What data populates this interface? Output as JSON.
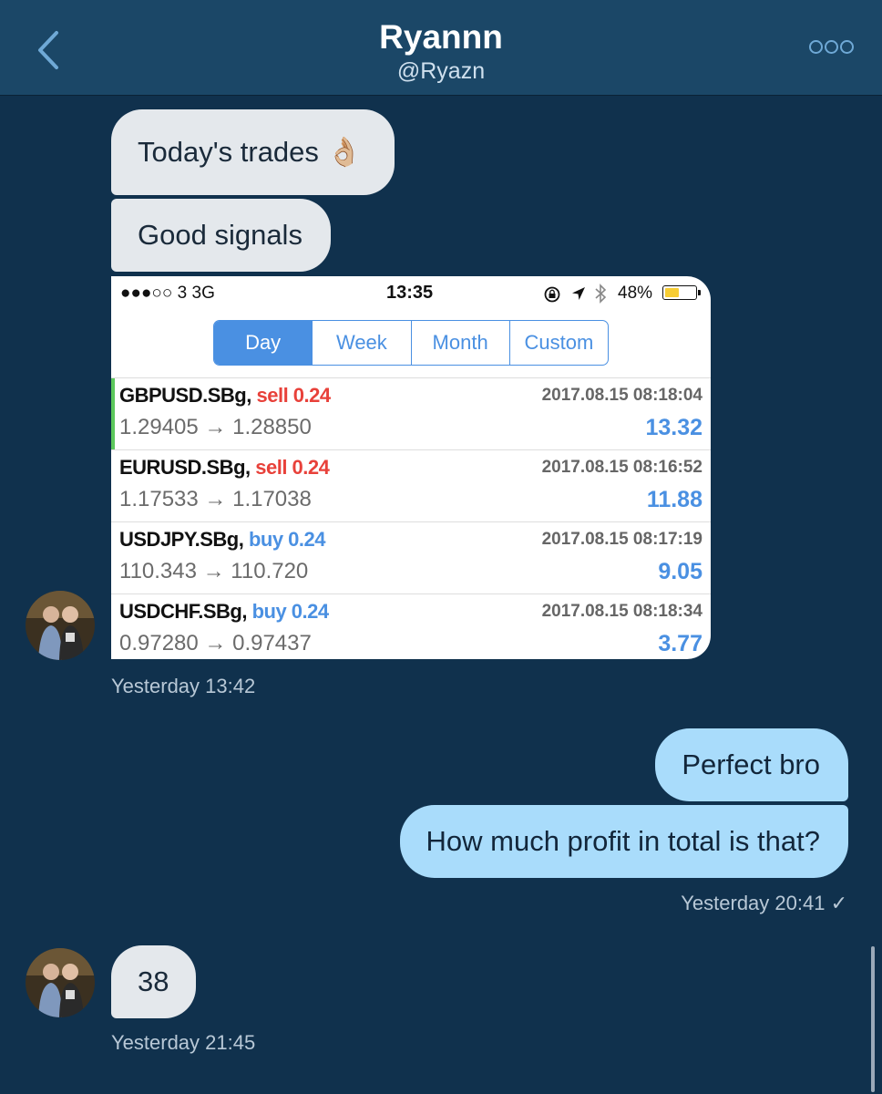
{
  "header": {
    "title": "Ryannn",
    "handle": "@Ryazn",
    "back_icon": "chevron-left-icon",
    "more_icon": "more-dots-icon"
  },
  "messages": {
    "in1": "Today's trades 👌🏼",
    "in2": "Good signals",
    "ts1": "Yesterday 13:42",
    "out1": "Perfect bro",
    "out2": "How much profit in total is that?",
    "ts2": "Yesterday 20:41 ✓",
    "in3": "38",
    "ts3": "Yesterday 21:45"
  },
  "screenshot": {
    "status": {
      "carrier": "●●●○○ 3   3G",
      "time": "13:35",
      "right": "48%",
      "battery_icon": "battery-icon",
      "battery_level": 0.48
    },
    "tabs": [
      "Day",
      "Week",
      "Month",
      "Custom"
    ],
    "active_tab": "Day",
    "trades": [
      {
        "symbol": "GBPUSD.SBg,",
        "side": "sell 0.24",
        "datetime": "2017.08.15 08:18:04",
        "prices": "1.29405 → 1.28850",
        "profit": "13.32"
      },
      {
        "symbol": "EURUSD.SBg,",
        "side": "sell 0.24",
        "datetime": "2017.08.15 08:16:52",
        "prices": "1.17533 → 1.17038",
        "profit": "11.88"
      },
      {
        "symbol": "USDJPY.SBg,",
        "side": "buy 0.24",
        "datetime": "2017.08.15 08:17:19",
        "prices": "110.343 → 110.720",
        "profit": "9.05"
      },
      {
        "symbol": "USDCHF.SBg,",
        "side": "buy 0.24",
        "datetime": "2017.08.15 08:18:34",
        "prices": "0.97280 → 0.97437",
        "profit": "3.77"
      }
    ]
  },
  "colors": {
    "background": "#10314d",
    "header": "#1b4767",
    "incoming_bubble": "#e4e8ec",
    "outgoing_bubble": "#a9dcfb",
    "accent": "#4a90e2",
    "sell": "#e8413a"
  }
}
